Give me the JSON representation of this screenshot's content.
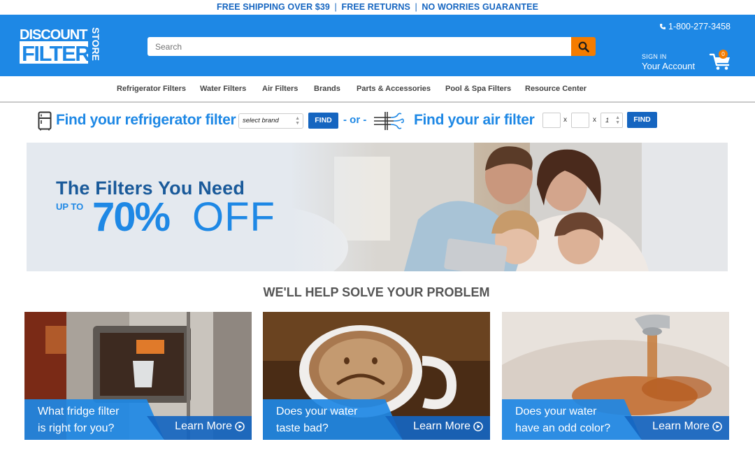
{
  "promo": {
    "part1": "FREE SHIPPING OVER $39",
    "part2": "FREE RETURNS",
    "part3": "NO WORRIES GUARANTEE",
    "separator": "|"
  },
  "header": {
    "logo_words": [
      "DISCOUNT",
      "FILTER",
      "STORE"
    ],
    "search_placeholder": "Search",
    "phone": "1-800-277-3458",
    "account_small": "SIGN IN",
    "account_big": "Your Account",
    "cart_count": "0",
    "brand_blue": "#1e88e5",
    "accent_orange": "#f57c00"
  },
  "nav": {
    "items": [
      "Refrigerator Filters",
      "Water Filters",
      "Air Filters",
      "Brands",
      "Parts & Accessories",
      "Pool & Spa Filters",
      "Resource Center"
    ]
  },
  "finder": {
    "fridge_title": "Find your refrigerator filter",
    "brand_select": "select brand",
    "find_label": "FIND",
    "or_label": "- or -",
    "air_title": "Find your air filter",
    "x_label": "x",
    "qty_value": "1"
  },
  "hero": {
    "title": "The Filters You Need",
    "upto": "UP TO",
    "percent": "70%",
    "off": "OFF"
  },
  "section": {
    "title": "WE'LL HELP SOLVE YOUR PROBLEM"
  },
  "cards": [
    {
      "line1": "What fridge filter",
      "line2": "is right for you?",
      "cta": "Learn More"
    },
    {
      "line1": "Does your water",
      "line2": "taste bad?",
      "cta": "Learn More"
    },
    {
      "line1": "Does your water",
      "line2": "have an odd color?",
      "cta": "Learn More"
    }
  ]
}
